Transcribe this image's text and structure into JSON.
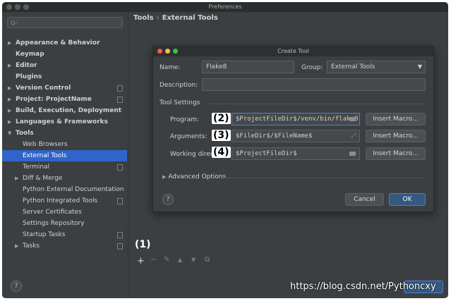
{
  "window": {
    "title": "Preferences"
  },
  "search": {
    "placeholder": "Q-"
  },
  "breadcrumb": {
    "parent": "Tools",
    "separator": "›",
    "current": "External Tools"
  },
  "sidebar": {
    "items": [
      {
        "label": "Appearance & Behavior",
        "arrow": "▶",
        "bold": true,
        "copy": false
      },
      {
        "label": "Keymap",
        "arrow": "",
        "bold": true,
        "copy": false
      },
      {
        "label": "Editor",
        "arrow": "▶",
        "bold": true,
        "copy": false
      },
      {
        "label": "Plugins",
        "arrow": "",
        "bold": true,
        "copy": false
      },
      {
        "label": "Version Control",
        "arrow": "▶",
        "bold": true,
        "copy": true
      },
      {
        "label": "Project: ProjectName",
        "arrow": "▶",
        "bold": true,
        "copy": true
      },
      {
        "label": "Build, Execution, Deployment",
        "arrow": "▶",
        "bold": true,
        "copy": false
      },
      {
        "label": "Languages & Frameworks",
        "arrow": "▶",
        "bold": true,
        "copy": false
      },
      {
        "label": "Tools",
        "arrow": "▼",
        "bold": true,
        "copy": false
      },
      {
        "label": "Web Browsers",
        "arrow": "",
        "bold": false,
        "copy": false
      },
      {
        "label": "External Tools",
        "arrow": "",
        "bold": false,
        "copy": false,
        "selected": true
      },
      {
        "label": "Terminal",
        "arrow": "",
        "bold": false,
        "copy": true
      },
      {
        "label": "Diff & Merge",
        "arrow": "▶",
        "bold": false,
        "copy": false
      },
      {
        "label": "Python External Documentation",
        "arrow": "",
        "bold": false,
        "copy": false
      },
      {
        "label": "Python Integrated Tools",
        "arrow": "",
        "bold": false,
        "copy": true
      },
      {
        "label": "Server Certificates",
        "arrow": "",
        "bold": false,
        "copy": false
      },
      {
        "label": "Settings Repository",
        "arrow": "",
        "bold": false,
        "copy": false
      },
      {
        "label": "Startup Tasks",
        "arrow": "",
        "bold": false,
        "copy": true
      },
      {
        "label": "Tasks",
        "arrow": "▶",
        "bold": false,
        "copy": true
      }
    ]
  },
  "dialog": {
    "title": "Create Tool",
    "name_label": "Name:",
    "name_value": "Flake8",
    "group_label": "Group:",
    "group_value": "External Tools",
    "description_label": "Description:",
    "description_value": "",
    "tool_settings_label": "Tool Settings",
    "program_label": "Program:",
    "program_value": "$ProjectFileDir$/venv/bin/flake8",
    "arguments_label": "Arguments:",
    "arguments_value": "$FileDir$/$FileName$",
    "workdir_label": "Working direc",
    "workdir_value": "$ProjectFileDir$",
    "insert_macro": "Insert Macro...",
    "advanced_label": "Advanced Options",
    "cancel": "Cancel",
    "ok": "OK",
    "help": "?"
  },
  "annotations": {
    "a1": "(1)",
    "a2": "(2)",
    "a3": "(3)",
    "a4": "(4)"
  },
  "toolbar": {
    "add": "+",
    "remove": "−",
    "edit": "✎",
    "up": "▲",
    "down": "▼",
    "copy": "⧉"
  },
  "footer": {
    "help": "?",
    "watermark": "https://blog.csdn.net/Pythoncxy"
  },
  "colors": {
    "accent": "#2f65ca",
    "panel": "#3b3f41",
    "dialog": "#3c3f41"
  }
}
